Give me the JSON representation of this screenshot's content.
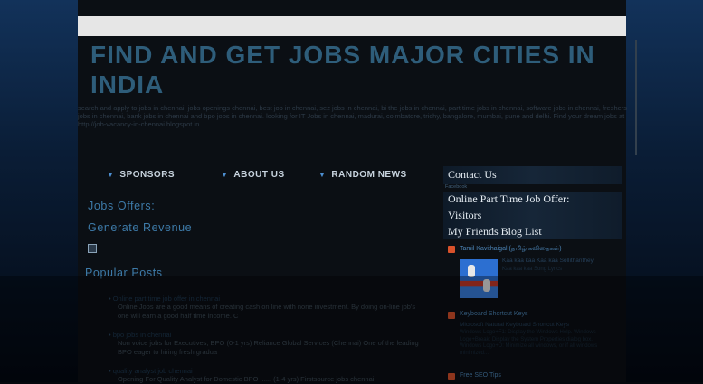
{
  "header": {
    "title": "FIND AND GET JOBS MAJOR CITIES IN INDIA",
    "description": "search and apply to jobs in chennai, jobs openings chennai, best job in chennai, sez jobs in chennai, bi the jobs in chennai, part time jobs in chennai, software jobs in chennai, freshers jobs in chennai, bank jobs in chennai and bpo jobs in chennai. looking for IT Jobs in chennai, madurai, coimbatore, trichy, bangalore, mumbai, pune and delhi. Find your dream jobs at http://job-vacancy-in-chennai.blogspot.in"
  },
  "nav": {
    "items": [
      {
        "label": "SPONSORS"
      },
      {
        "label": "ABOUT US"
      },
      {
        "label": "RANDOM NEWS"
      }
    ]
  },
  "main": {
    "jobs_offers": "Jobs Offers:",
    "generate_revenue": "Generate Revenue",
    "popular_posts_title": "Popular Posts",
    "posts": [
      {
        "link": "Online part time job offer in chennai",
        "text": "Online Jobs are a good means of creating cash on line with none investment. By doing on-line job's one will earn a good half time income. C"
      },
      {
        "link": "bpo jobs in chennai",
        "text": "Non voice jobs for Executives, BPO (0-1 yrs) Reliance Global Services (Chennai) One of the leading BPO eager to hiring fresh gradua"
      },
      {
        "link": "quality analyst job chennai",
        "text": "Opening For Quality Analyst for Domestic BPO ...... (1-4 yrs) Firstsource jobs chennai"
      }
    ]
  },
  "sidebar": {
    "contact_title": "Contact Us",
    "facebook_label": "Facebook",
    "part_time_title": "Online Part Time Job Offer:",
    "visitors_title": "Visitors",
    "blog_list_title": "My Friends Blog List",
    "blogs": [
      {
        "name": "Tamil Kavithaigal (தமிழ் கவிதைகள்)",
        "post": "Kaa kaa kaa Kaa kaa Sollithanthey",
        "snippet": "Kaa kaa kaa Song Lyrics"
      },
      {
        "name": "Keyboard Shortcut Keys",
        "post": "Microsoft Natural Keyboard Shortcut Keys",
        "snippet": "Windows Logo+F1: Display the Windows Help. Windows Logo+Break: Display the System Properties dialog box. Windows Logo+D: Minimize all windows, or if all windows minimized..."
      },
      {
        "name": "Free SEO Tips",
        "post": "",
        "snippet": ""
      }
    ]
  }
}
